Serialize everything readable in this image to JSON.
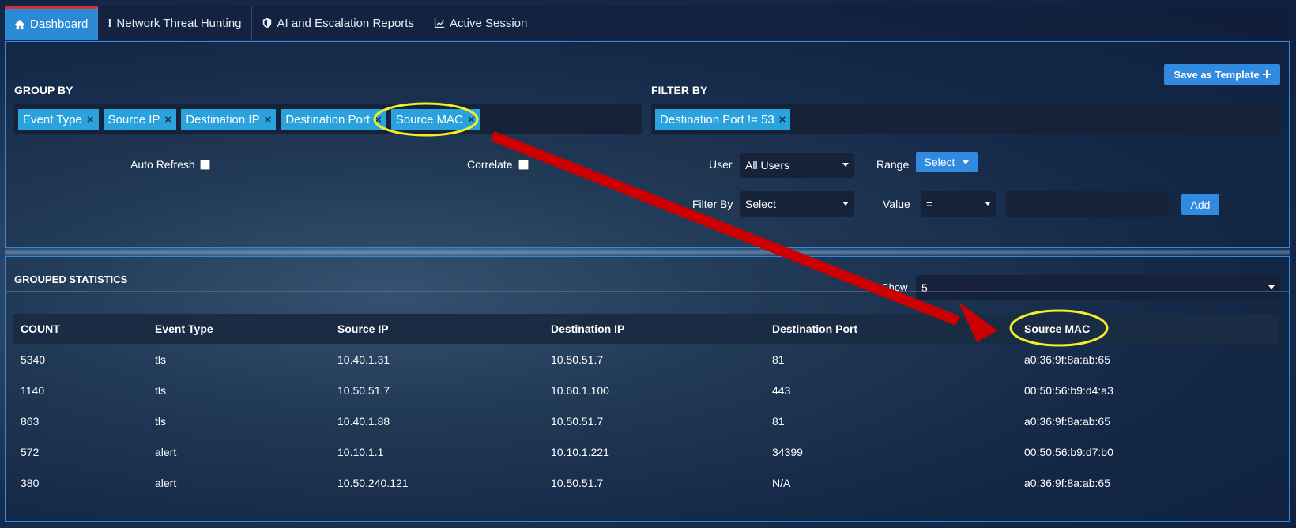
{
  "tabs": [
    {
      "label": "Dashboard",
      "icon": "home-icon"
    },
    {
      "label": "Network Threat Hunting",
      "icon": "exclamation-icon"
    },
    {
      "label": "AI and Escalation Reports",
      "icon": "shield-icon"
    },
    {
      "label": "Active Session",
      "icon": "line-chart-icon"
    }
  ],
  "filters": {
    "group_by_label": "GROUP BY",
    "filter_by_label": "FILTER BY",
    "save_template_label": "Save as Template",
    "group_by_tags": [
      "Event Type",
      "Source IP",
      "Destination IP",
      "Destination Port",
      "Source MAC"
    ],
    "filter_by_tags": [
      "Destination Port != 53"
    ],
    "tag_remove_symbol": "×",
    "auto_refresh_label": "Auto Refresh",
    "correlate_label": "Correlate",
    "user_label": "User",
    "user_value": "All Users",
    "range_label": "Range",
    "range_button_label": "Select",
    "filter_by_field_label": "Filter By",
    "filter_by_value": "Select",
    "value_label": "Value",
    "operator_value": "=",
    "add_label": "Add"
  },
  "stats": {
    "title": "GROUPED STATISTICS",
    "show_label": "Show",
    "show_value": "5",
    "columns": [
      "COUNT",
      "Event Type",
      "Source IP",
      "Destination IP",
      "Destination Port",
      "Source MAC"
    ],
    "rows": [
      [
        "5340",
        "tls",
        "10.40.1.31",
        "10.50.51.7",
        "81",
        "a0:36:9f:8a:ab:65"
      ],
      [
        "1140",
        "tls",
        "10.50.51.7",
        "10.60.1.100",
        "443",
        "00:50:56:b9:d4:a3"
      ],
      [
        "863",
        "tls",
        "10.40.1.88",
        "10.50.51.7",
        "81",
        "a0:36:9f:8a:ab:65"
      ],
      [
        "572",
        "alert",
        "10.10.1.1",
        "10.10.1.221",
        "34399",
        "00:50:56:b9:d7:b0"
      ],
      [
        "380",
        "alert",
        "10.50.240.121",
        "10.50.51.7",
        "N/A",
        "a0:36:9f:8a:ab:65"
      ]
    ]
  },
  "colors": {
    "accent": "#2f8ae0",
    "tag": "#2aa2de",
    "active_tab_border": "#d0323a",
    "annotation_circle": "#f2ee2a",
    "annotation_arrow": "#cc0000"
  }
}
